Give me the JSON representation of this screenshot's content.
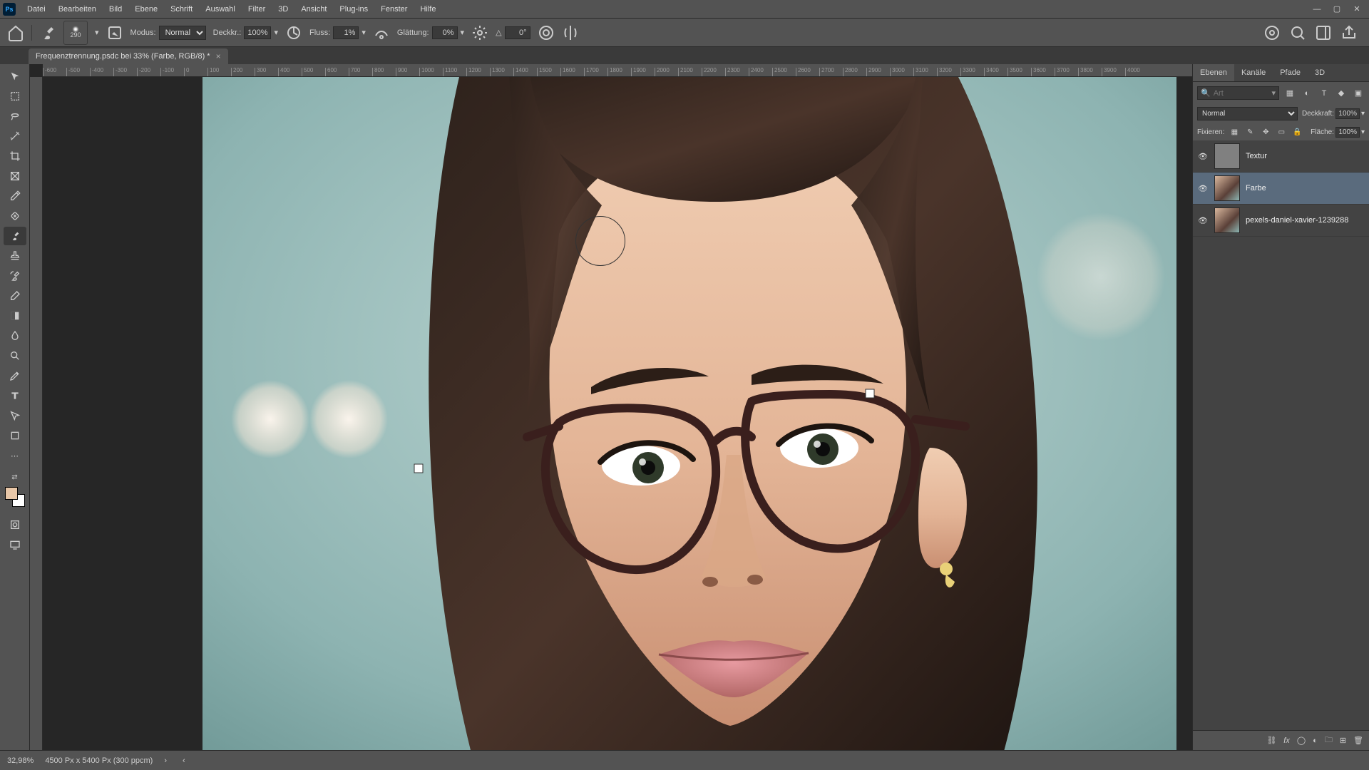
{
  "menubar": [
    "Datei",
    "Bearbeiten",
    "Bild",
    "Ebene",
    "Schrift",
    "Auswahl",
    "Filter",
    "3D",
    "Ansicht",
    "Plug-ins",
    "Fenster",
    "Hilfe"
  ],
  "options": {
    "brush_size": "290",
    "mode_label": "Modus:",
    "mode_value": "Normal",
    "opacity_label": "Deckkr.:",
    "opacity_value": "100%",
    "flow_label": "Fluss:",
    "flow_value": "1%",
    "smooth_label": "Glättung:",
    "smooth_value": "0%",
    "angle_value": "0°"
  },
  "doc": {
    "title": "Frequenztrennung.psdc bei 33% (Farbe, RGB/8) *"
  },
  "ruler_ticks": [
    "-600",
    "-500",
    "-400",
    "-300",
    "-200",
    "-100",
    "0",
    "100",
    "200",
    "300",
    "400",
    "500",
    "600",
    "700",
    "800",
    "900",
    "1000",
    "1100",
    "1200",
    "1300",
    "1400",
    "1500",
    "1600",
    "1700",
    "1800",
    "1900",
    "2000",
    "2100",
    "2200",
    "2300",
    "2400",
    "2500",
    "2600",
    "2700",
    "2800",
    "2900",
    "3000",
    "3100",
    "3200",
    "3300",
    "3400",
    "3500",
    "3600",
    "3700",
    "3800",
    "3900",
    "4000"
  ],
  "panel_tabs": {
    "layers": "Ebenen",
    "channels": "Kanäle",
    "paths": "Pfade",
    "threed": "3D"
  },
  "search_placeholder": "Art",
  "blend": {
    "mode": "Normal",
    "opacity_label": "Deckkraft:",
    "opacity": "100%"
  },
  "lock": {
    "label": "Fixieren:",
    "fill_label": "Fläche:",
    "fill": "100%"
  },
  "layers": [
    {
      "name": "Textur",
      "thumb": "grey"
    },
    {
      "name": "Farbe",
      "thumb": "img",
      "selected": true
    },
    {
      "name": "pexels-daniel-xavier-1239288",
      "thumb": "img"
    }
  ],
  "status": {
    "zoom": "32,98%",
    "docinfo": "4500 Px x 5400 Px (300 ppcm)"
  }
}
